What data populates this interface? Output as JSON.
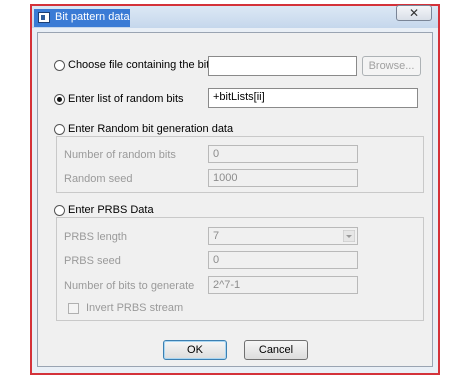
{
  "window": {
    "title": "Bit pattern data",
    "close_glyph": "✕"
  },
  "bitlist_file": {
    "radio_label": "Choose file containing the bitlist",
    "value": "",
    "browse_label": "Browse..."
  },
  "random_list": {
    "radio_label": "Enter list of random bits",
    "value": "+bitLists[ii]"
  },
  "random_generation": {
    "radio_label": "Enter Random bit generation data",
    "num_bits_label": "Number of random bits",
    "num_bits_value": "0",
    "seed_label": "Random seed",
    "seed_value": "1000"
  },
  "prbs": {
    "radio_label": "Enter PRBS Data",
    "length_label": "PRBS length",
    "length_value": "7",
    "seed_label": "PRBS seed",
    "seed_value": "0",
    "bits_label": "Number of bits to generate",
    "bits_value": "2^7-1",
    "invert_label": "Invert PRBS stream"
  },
  "buttons": {
    "ok": "OK",
    "cancel": "Cancel"
  },
  "colors": {
    "frame_border": "#d4323a",
    "title_highlight": "#3a7bd5"
  },
  "icons": {
    "app": "window-app-icon",
    "close": "close-icon",
    "dropdown": "chevron-down-icon"
  },
  "selected_option": "random_list"
}
